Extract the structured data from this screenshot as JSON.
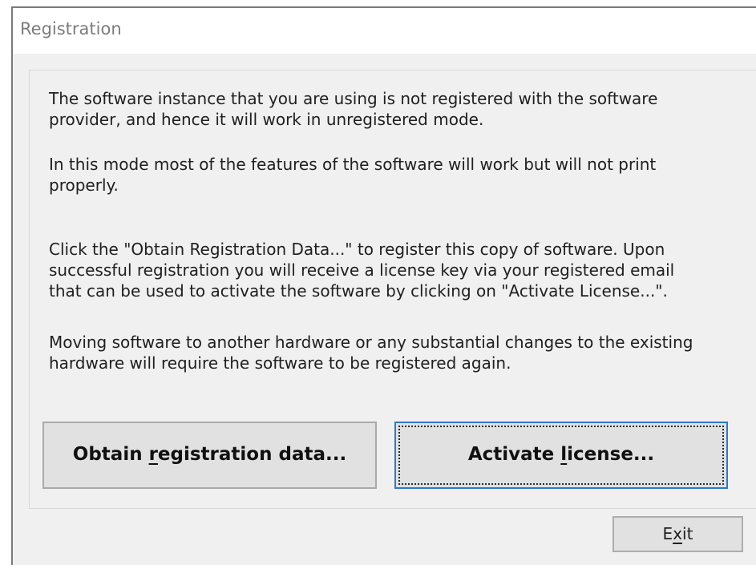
{
  "window": {
    "title": "Registration"
  },
  "message": {
    "paragraph_1": [
      "The software instance that you are using is not registered with the software",
      "provider, and hence it will work in unregistered mode."
    ],
    "paragraph_2": [
      "In this mode most of the features of the software will work but will not print",
      "properly."
    ],
    "paragraph_3": [
      "Click the \"Obtain Registration Data...\" to register this copy of software. Upon",
      "successful registration you will receive a license key via your registered email",
      "that can be used to activate the software by clicking on \"Activate License...\"."
    ],
    "paragraph_4": [
      "Moving software to another hardware or any substantial changes to the existing",
      "hardware will require the software to be registered again."
    ]
  },
  "buttons": {
    "obtain": {
      "before": "Obtain ",
      "mnemonic": "r",
      "after": "egistration data..."
    },
    "activate": {
      "before": "Activate ",
      "mnemonic": "l",
      "after": "icense..."
    },
    "exit": {
      "before": "E",
      "mnemonic": "x",
      "after": "it"
    }
  },
  "colors": {
    "dialog_background": "#f0f0f0",
    "title_text": "#7c7c7c",
    "focused_button_border": "#2b7ac8"
  }
}
